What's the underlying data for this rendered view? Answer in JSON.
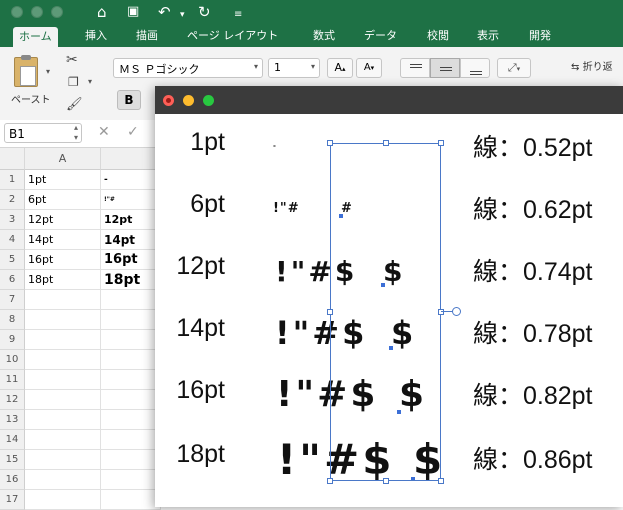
{
  "ribbon": {
    "tabs": [
      "ホーム",
      "挿入",
      "描画",
      "ページ レイアウト",
      "数式",
      "データ",
      "校閲",
      "表示",
      "開発"
    ],
    "active_tab": "ホーム",
    "paste_label": "ペースト",
    "font_name": "ＭＳ Ｐゴシック",
    "font_size": "1",
    "bold_label": "B",
    "wrap_label": "折り返"
  },
  "formula_bar": {
    "name_box": "B1",
    "cancel_symbol": "✕",
    "enter_symbol": "✓"
  },
  "sheet": {
    "column_header": "A",
    "row_numbers": [
      "1",
      "2",
      "3",
      "4",
      "5",
      "6",
      "7",
      "8",
      "9",
      "10",
      "11",
      "12",
      "13",
      "14",
      "15",
      "16",
      "17"
    ],
    "rows": [
      {
        "a": "1pt",
        "b": "-"
      },
      {
        "a": "6pt",
        "b": "!\"#"
      },
      {
        "a": "12pt",
        "b": "12pt"
      },
      {
        "a": "14pt",
        "b": "14pt"
      },
      {
        "a": "16pt",
        "b": "16pt"
      },
      {
        "a": "18pt",
        "b": "18pt"
      }
    ]
  },
  "preview": {
    "rows": [
      {
        "size": "1pt",
        "glyphs": "-",
        "sel": "",
        "line": "線：0.52pt"
      },
      {
        "size": "6pt",
        "glyphs": "!\"#",
        "sel": "#",
        "line": "線：0.62pt"
      },
      {
        "size": "12pt",
        "glyphs": "!\"#$",
        "sel": "$",
        "line": "線：0.74pt"
      },
      {
        "size": "14pt",
        "glyphs": "!\"#$",
        "sel": "$",
        "line": "線：0.78pt"
      },
      {
        "size": "16pt",
        "glyphs": "!\"#$",
        "sel": "$",
        "line": "線：0.82pt"
      },
      {
        "size": "18pt",
        "glyphs": "!\"#$",
        "sel": "$",
        "line": "線：0.86pt"
      }
    ]
  },
  "colors": {
    "excel_green": "#1e7145",
    "close": "#fe5f57",
    "minimize": "#febc2e",
    "zoom": "#28c840",
    "selection": "#4a78c8"
  }
}
